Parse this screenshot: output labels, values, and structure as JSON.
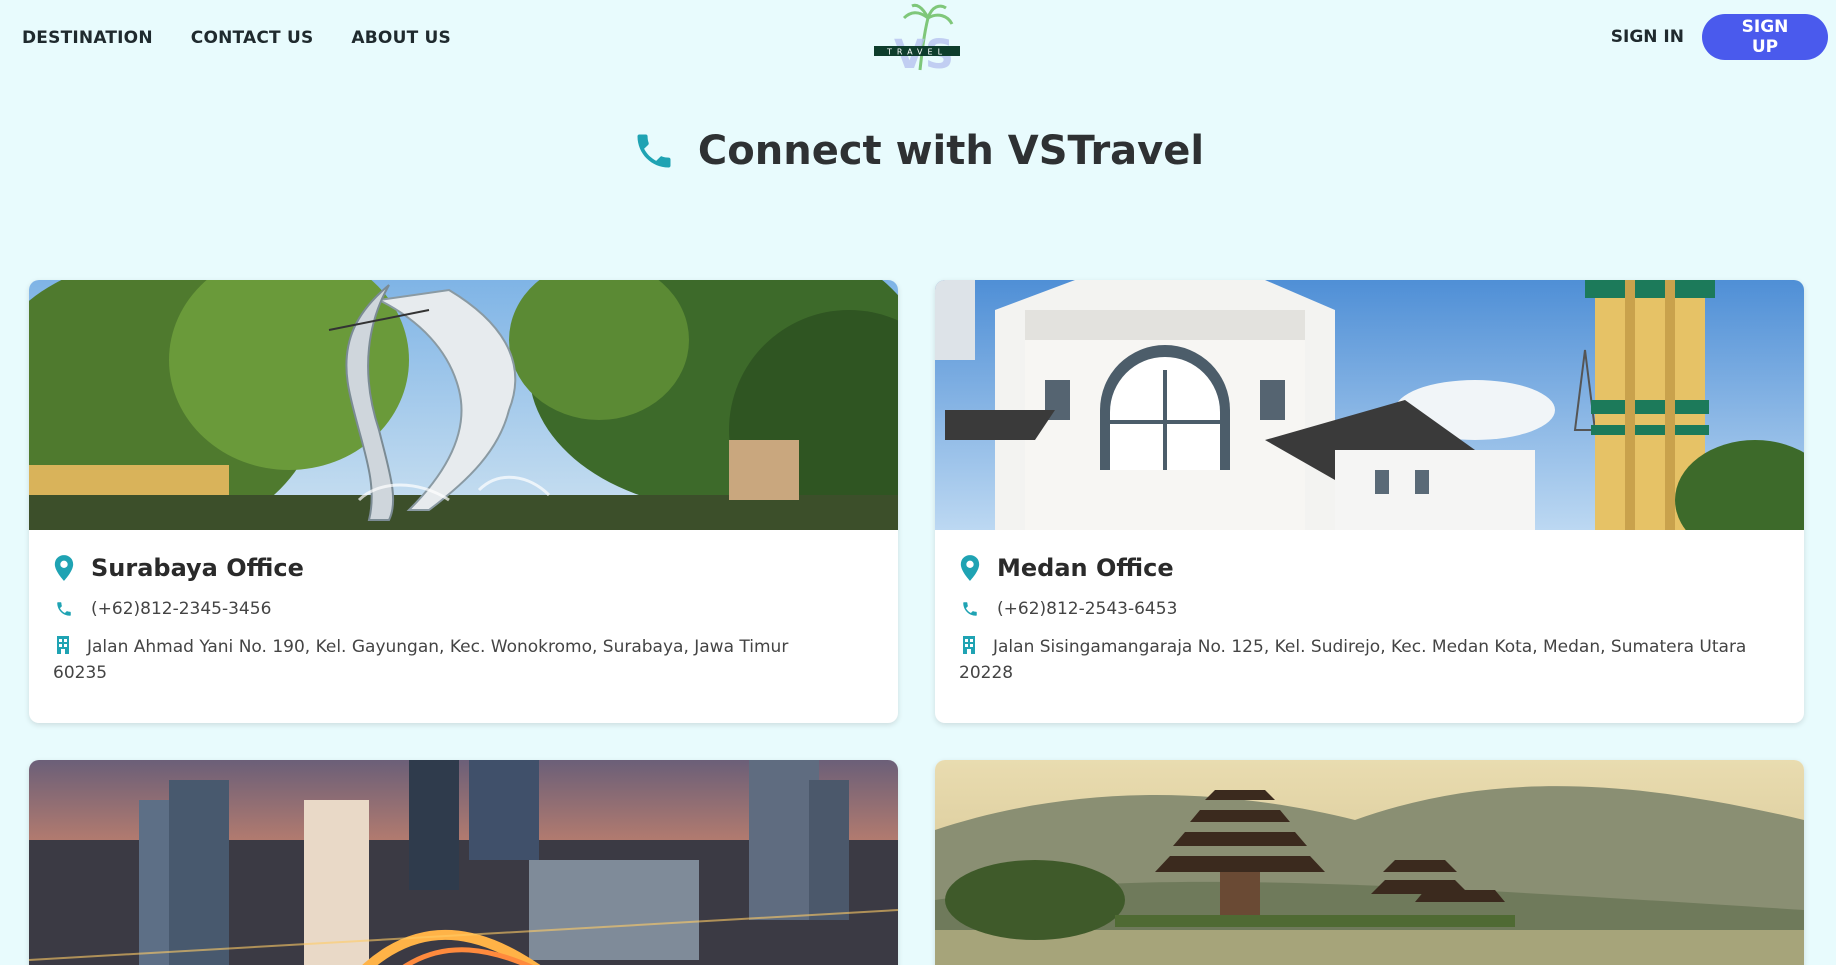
{
  "nav": {
    "left_links": [
      "DESTINATION",
      "CONTACT US",
      "ABOUT US"
    ],
    "logo_text": "TRAVEL",
    "logo_letters": "VS",
    "signin_label": "SIGN IN",
    "signup_label": "SIGN UP"
  },
  "page": {
    "title": "Connect with VSTravel",
    "title_icon": "phone-icon"
  },
  "offices": [
    {
      "name": "Surabaya Office",
      "phone": "(+62)812-2345-3456",
      "address_line1": "Jalan Ahmad Yani No. 190, Kel. Gayungan, Kec. Wonokromo, Surabaya, Jawa Timur",
      "address_line2": "60235"
    },
    {
      "name": "Medan Office",
      "phone": "(+62)812-2543-6453",
      "address_line1": "Jalan Sisingamangaraja No. 125, Kel. Sudirejo, Kec. Medan Kota, Medan, Sumatera Utara",
      "address_line2": "20228"
    }
  ],
  "colors": {
    "accent": "#1fa3b3",
    "signup": "#4a5aed",
    "background": "#e8fbfd"
  }
}
